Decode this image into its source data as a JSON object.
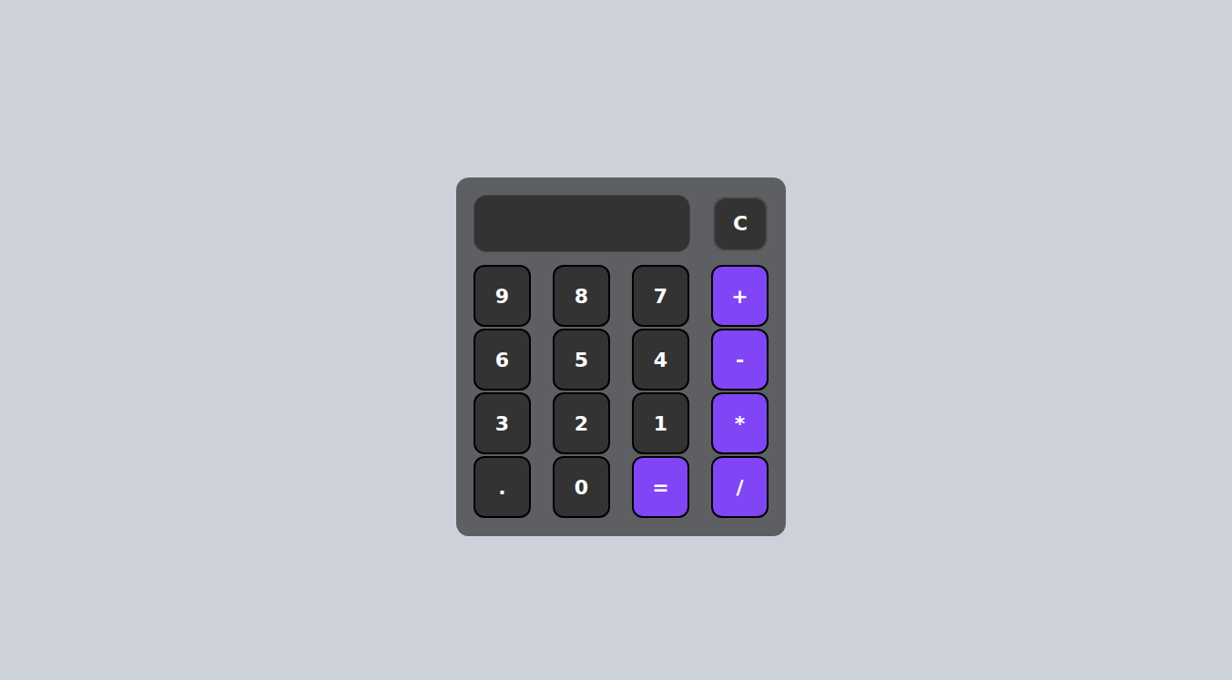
{
  "display": {
    "value": ""
  },
  "clear_button": "C",
  "keys": [
    {
      "label": "9",
      "kind": "digit"
    },
    {
      "label": "8",
      "kind": "digit"
    },
    {
      "label": "7",
      "kind": "digit"
    },
    {
      "label": "+",
      "kind": "operator"
    },
    {
      "label": "6",
      "kind": "digit"
    },
    {
      "label": "5",
      "kind": "digit"
    },
    {
      "label": "4",
      "kind": "digit"
    },
    {
      "label": "-",
      "kind": "operator"
    },
    {
      "label": "3",
      "kind": "digit"
    },
    {
      "label": "2",
      "kind": "digit"
    },
    {
      "label": "1",
      "kind": "digit"
    },
    {
      "label": "*",
      "kind": "operator"
    },
    {
      "label": ".",
      "kind": "digit"
    },
    {
      "label": "0",
      "kind": "digit"
    },
    {
      "label": "=",
      "kind": "operator"
    },
    {
      "label": "/",
      "kind": "operator"
    }
  ]
}
